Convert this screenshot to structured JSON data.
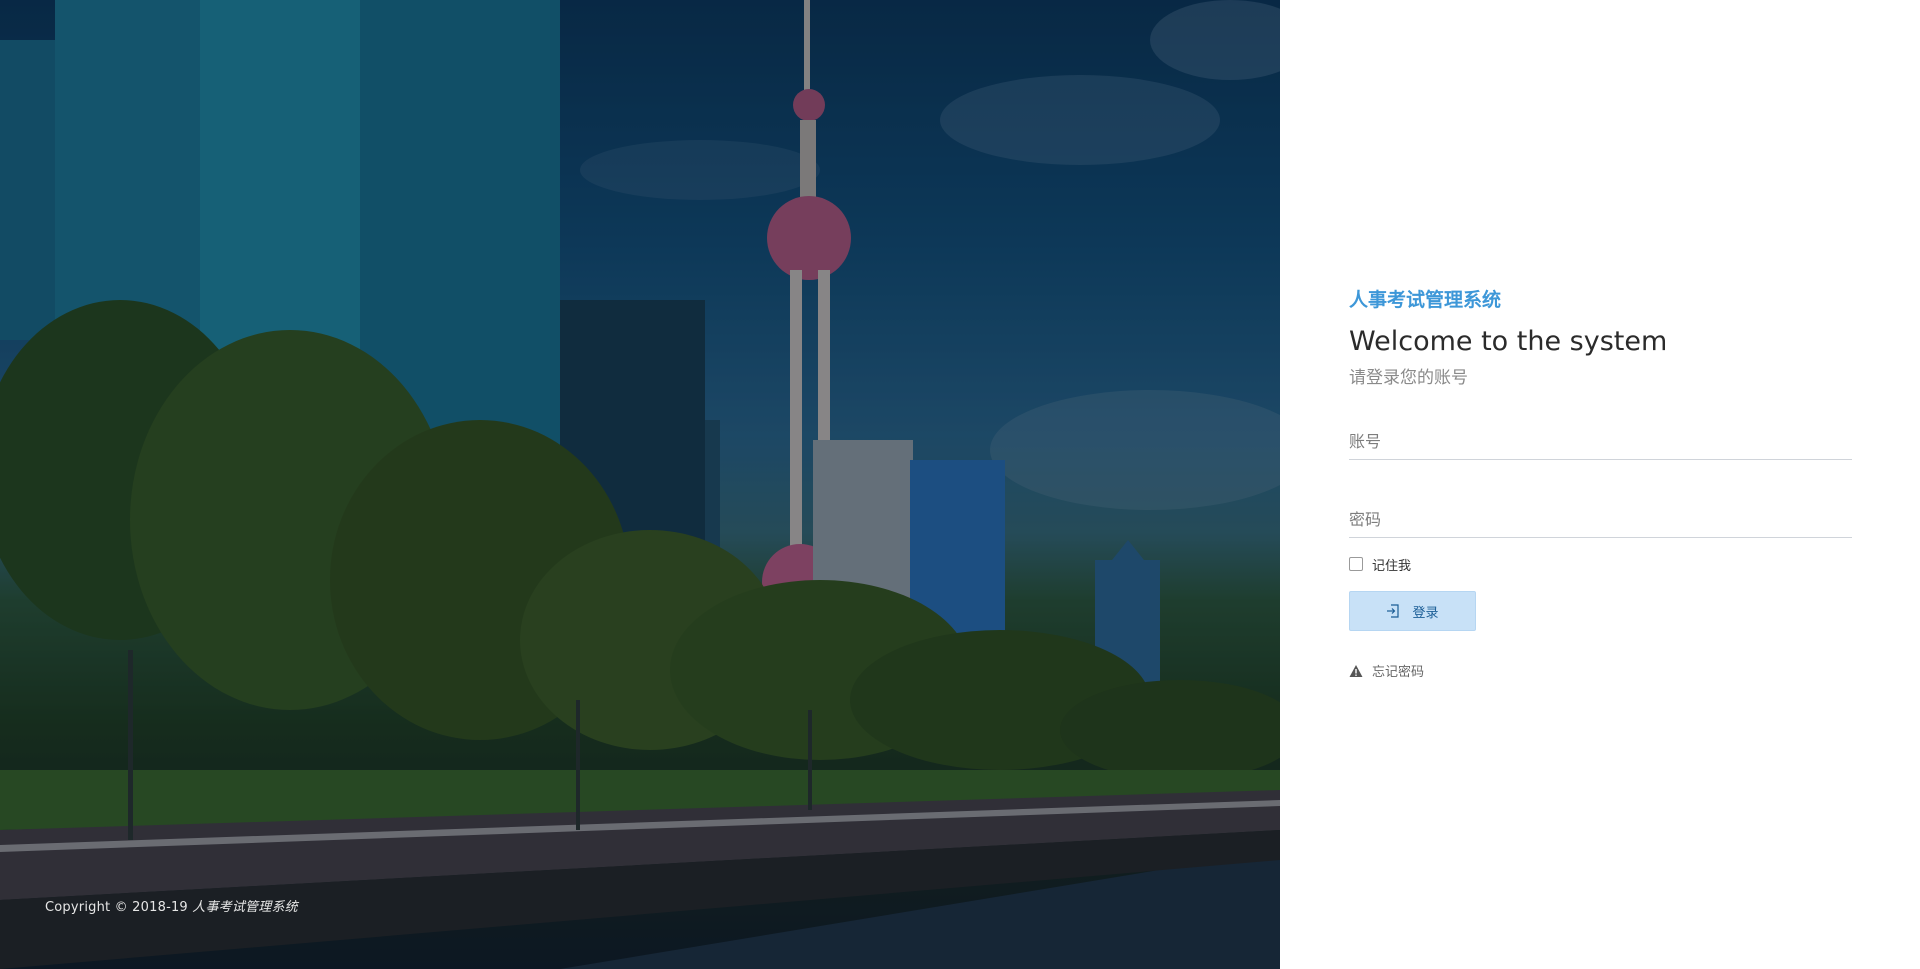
{
  "app": {
    "title": "人事考试管理系统",
    "welcome": "Welcome to the system",
    "subtitle": "请登录您的账号"
  },
  "form": {
    "account_placeholder": "账号",
    "password_placeholder": "密码",
    "remember_label": "记住我",
    "login_label": "登录",
    "forgot_label": "忘记密码"
  },
  "footer": {
    "copyright_prefix": "Copyright © 2018-19",
    "copyright_brand": "人事考试管理系统"
  },
  "icons": {
    "login": "sign-in-icon",
    "forgot": "warning-icon"
  },
  "colors": {
    "accent": "#3d97d8",
    "button_bg": "#c8e1f7",
    "button_text": "#1a5d96"
  }
}
